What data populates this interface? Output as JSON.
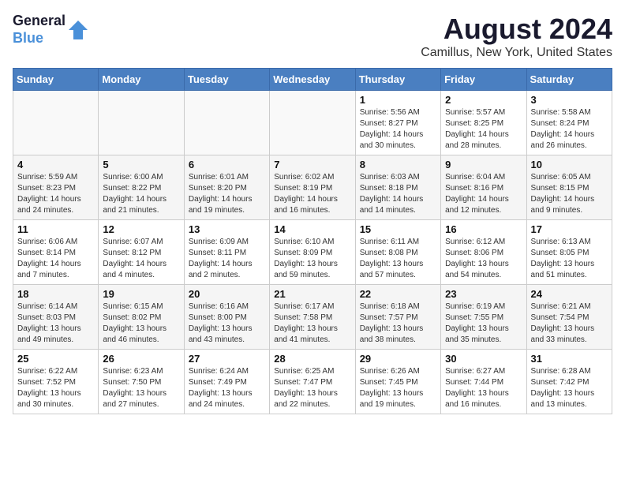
{
  "header": {
    "logo_line1": "General",
    "logo_line2": "Blue",
    "month_year": "August 2024",
    "location": "Camillus, New York, United States"
  },
  "days_of_week": [
    "Sunday",
    "Monday",
    "Tuesday",
    "Wednesday",
    "Thursday",
    "Friday",
    "Saturday"
  ],
  "weeks": [
    [
      {
        "num": "",
        "info": ""
      },
      {
        "num": "",
        "info": ""
      },
      {
        "num": "",
        "info": ""
      },
      {
        "num": "",
        "info": ""
      },
      {
        "num": "1",
        "info": "Sunrise: 5:56 AM\nSunset: 8:27 PM\nDaylight: 14 hours\nand 30 minutes."
      },
      {
        "num": "2",
        "info": "Sunrise: 5:57 AM\nSunset: 8:25 PM\nDaylight: 14 hours\nand 28 minutes."
      },
      {
        "num": "3",
        "info": "Sunrise: 5:58 AM\nSunset: 8:24 PM\nDaylight: 14 hours\nand 26 minutes."
      }
    ],
    [
      {
        "num": "4",
        "info": "Sunrise: 5:59 AM\nSunset: 8:23 PM\nDaylight: 14 hours\nand 24 minutes."
      },
      {
        "num": "5",
        "info": "Sunrise: 6:00 AM\nSunset: 8:22 PM\nDaylight: 14 hours\nand 21 minutes."
      },
      {
        "num": "6",
        "info": "Sunrise: 6:01 AM\nSunset: 8:20 PM\nDaylight: 14 hours\nand 19 minutes."
      },
      {
        "num": "7",
        "info": "Sunrise: 6:02 AM\nSunset: 8:19 PM\nDaylight: 14 hours\nand 16 minutes."
      },
      {
        "num": "8",
        "info": "Sunrise: 6:03 AM\nSunset: 8:18 PM\nDaylight: 14 hours\nand 14 minutes."
      },
      {
        "num": "9",
        "info": "Sunrise: 6:04 AM\nSunset: 8:16 PM\nDaylight: 14 hours\nand 12 minutes."
      },
      {
        "num": "10",
        "info": "Sunrise: 6:05 AM\nSunset: 8:15 PM\nDaylight: 14 hours\nand 9 minutes."
      }
    ],
    [
      {
        "num": "11",
        "info": "Sunrise: 6:06 AM\nSunset: 8:14 PM\nDaylight: 14 hours\nand 7 minutes."
      },
      {
        "num": "12",
        "info": "Sunrise: 6:07 AM\nSunset: 8:12 PM\nDaylight: 14 hours\nand 4 minutes."
      },
      {
        "num": "13",
        "info": "Sunrise: 6:09 AM\nSunset: 8:11 PM\nDaylight: 14 hours\nand 2 minutes."
      },
      {
        "num": "14",
        "info": "Sunrise: 6:10 AM\nSunset: 8:09 PM\nDaylight: 13 hours\nand 59 minutes."
      },
      {
        "num": "15",
        "info": "Sunrise: 6:11 AM\nSunset: 8:08 PM\nDaylight: 13 hours\nand 57 minutes."
      },
      {
        "num": "16",
        "info": "Sunrise: 6:12 AM\nSunset: 8:06 PM\nDaylight: 13 hours\nand 54 minutes."
      },
      {
        "num": "17",
        "info": "Sunrise: 6:13 AM\nSunset: 8:05 PM\nDaylight: 13 hours\nand 51 minutes."
      }
    ],
    [
      {
        "num": "18",
        "info": "Sunrise: 6:14 AM\nSunset: 8:03 PM\nDaylight: 13 hours\nand 49 minutes."
      },
      {
        "num": "19",
        "info": "Sunrise: 6:15 AM\nSunset: 8:02 PM\nDaylight: 13 hours\nand 46 minutes."
      },
      {
        "num": "20",
        "info": "Sunrise: 6:16 AM\nSunset: 8:00 PM\nDaylight: 13 hours\nand 43 minutes."
      },
      {
        "num": "21",
        "info": "Sunrise: 6:17 AM\nSunset: 7:58 PM\nDaylight: 13 hours\nand 41 minutes."
      },
      {
        "num": "22",
        "info": "Sunrise: 6:18 AM\nSunset: 7:57 PM\nDaylight: 13 hours\nand 38 minutes."
      },
      {
        "num": "23",
        "info": "Sunrise: 6:19 AM\nSunset: 7:55 PM\nDaylight: 13 hours\nand 35 minutes."
      },
      {
        "num": "24",
        "info": "Sunrise: 6:21 AM\nSunset: 7:54 PM\nDaylight: 13 hours\nand 33 minutes."
      }
    ],
    [
      {
        "num": "25",
        "info": "Sunrise: 6:22 AM\nSunset: 7:52 PM\nDaylight: 13 hours\nand 30 minutes."
      },
      {
        "num": "26",
        "info": "Sunrise: 6:23 AM\nSunset: 7:50 PM\nDaylight: 13 hours\nand 27 minutes."
      },
      {
        "num": "27",
        "info": "Sunrise: 6:24 AM\nSunset: 7:49 PM\nDaylight: 13 hours\nand 24 minutes."
      },
      {
        "num": "28",
        "info": "Sunrise: 6:25 AM\nSunset: 7:47 PM\nDaylight: 13 hours\nand 22 minutes."
      },
      {
        "num": "29",
        "info": "Sunrise: 6:26 AM\nSunset: 7:45 PM\nDaylight: 13 hours\nand 19 minutes."
      },
      {
        "num": "30",
        "info": "Sunrise: 6:27 AM\nSunset: 7:44 PM\nDaylight: 13 hours\nand 16 minutes."
      },
      {
        "num": "31",
        "info": "Sunrise: 6:28 AM\nSunset: 7:42 PM\nDaylight: 13 hours\nand 13 minutes."
      }
    ]
  ]
}
